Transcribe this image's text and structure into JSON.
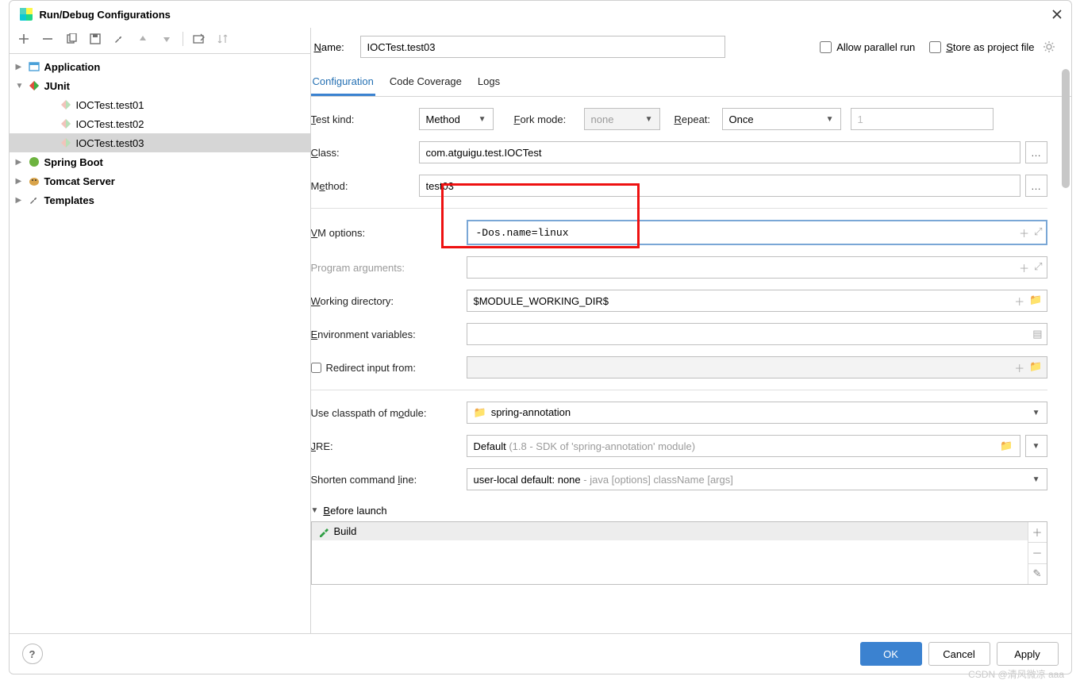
{
  "window": {
    "title": "Run/Debug Configurations"
  },
  "sidebar": {
    "items": [
      {
        "label": "Application",
        "bold": true
      },
      {
        "label": "JUnit",
        "bold": true
      },
      {
        "label": "IOCTest.test01"
      },
      {
        "label": "IOCTest.test02"
      },
      {
        "label": "IOCTest.test03",
        "selected": true
      },
      {
        "label": "Spring Boot",
        "bold": true
      },
      {
        "label": "Tomcat Server",
        "bold": true
      },
      {
        "label": "Templates",
        "bold": true
      }
    ]
  },
  "header": {
    "name_label": "Name:",
    "name_value": "IOCTest.test03",
    "allow_parallel": "Allow parallel run",
    "store_as_project": "Store as project file"
  },
  "tabs": {
    "items": [
      "Configuration",
      "Code Coverage",
      "Logs"
    ],
    "active": 0
  },
  "form": {
    "test_kind": {
      "label": "Test kind:",
      "value": "Method"
    },
    "fork_mode": {
      "label": "Fork mode:",
      "value": "none"
    },
    "repeat": {
      "label": "Repeat:",
      "value": "Once",
      "count": "1"
    },
    "class": {
      "label": "Class:",
      "value": "com.atguigu.test.IOCTest"
    },
    "method": {
      "label": "Method:",
      "value": "test03"
    },
    "vm_options": {
      "label": "VM options:",
      "value": "-Dos.name=linux"
    },
    "program_args": {
      "label": "Program arguments:"
    },
    "working_dir": {
      "label": "Working directory:",
      "value": "$MODULE_WORKING_DIR$"
    },
    "env_vars": {
      "label": "Environment variables:"
    },
    "redirect_input": {
      "label": "Redirect input from:"
    },
    "classpath": {
      "label": "Use classpath of module:",
      "value": "spring-annotation"
    },
    "jre": {
      "label": "JRE:",
      "value": "Default",
      "hint": "(1.8 - SDK of 'spring-annotation' module)"
    },
    "shorten": {
      "label": "Shorten command line:",
      "value": "user-local default: none",
      "hint": " - java [options] className [args]"
    },
    "before_launch": {
      "title": "Before launch",
      "item": "Build"
    }
  },
  "buttons": {
    "ok": "OK",
    "cancel": "Cancel",
    "apply": "Apply"
  },
  "watermark": "CSDN @清风微凉 aaa"
}
